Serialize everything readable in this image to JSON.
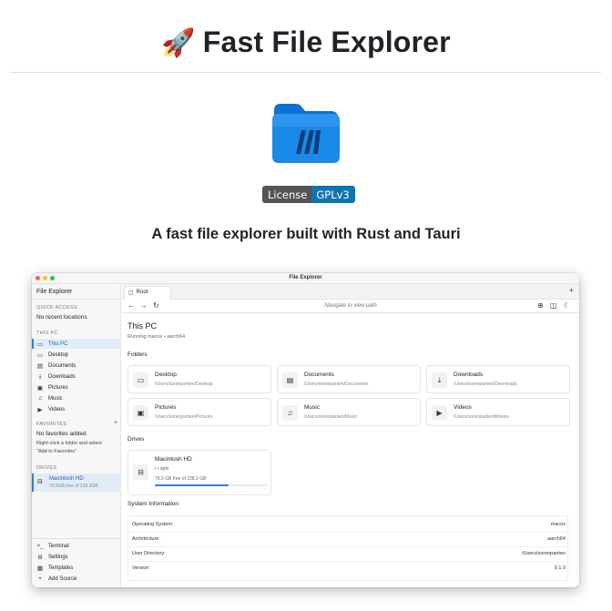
{
  "readme": {
    "title_emoji": "🚀",
    "title": "Fast File Explorer",
    "badge_label": "License",
    "badge_value": "GPLv3",
    "tagline": "A fast file explorer built with Rust and Tauri",
    "colors": {
      "badge_left": "#555555",
      "badge_right": "#0f74b4",
      "folder_blue": "#1a8ae8"
    }
  },
  "app": {
    "window_title": "File Explorer",
    "sidebar": {
      "header": "File Explorer",
      "quick_access": {
        "label": "QUICK ACCESS",
        "empty": "No recent locations"
      },
      "this_pc": {
        "label": "THIS PC",
        "items": [
          {
            "label": "This PC",
            "icon": "monitor-icon",
            "active": true
          },
          {
            "label": "Desktop",
            "icon": "monitor-icon"
          },
          {
            "label": "Documents",
            "icon": "document-icon"
          },
          {
            "label": "Downloads",
            "icon": "download-icon"
          },
          {
            "label": "Pictures",
            "icon": "image-icon"
          },
          {
            "label": "Music",
            "icon": "music-icon"
          },
          {
            "label": "Videos",
            "icon": "video-icon"
          }
        ]
      },
      "favorites": {
        "label": "FAVORITES",
        "add": "+",
        "empty": "No favorites added",
        "hint1": "Right-click a folder and select",
        "hint2": "\"Add to Favorites\""
      },
      "drives": {
        "label": "DRIVES",
        "item": {
          "name": "Macintosh HD",
          "free": "79.5GB free of 228.3GB"
        }
      },
      "bottom": [
        {
          "label": "Terminal",
          "icon": "terminal-icon"
        },
        {
          "label": "Settings",
          "icon": "gear-icon"
        },
        {
          "label": "Templates",
          "icon": "template-icon"
        },
        {
          "label": "Add Source",
          "icon": "plus-icon"
        }
      ]
    },
    "tab": {
      "label": "Root"
    },
    "tab_add": "+",
    "nav": {
      "path_placeholder": "Navigate to view path"
    },
    "page": {
      "title": "This PC",
      "subtitle": "Running macos • aarch64"
    },
    "folders_heading": "Folders",
    "folders": [
      {
        "name": "Desktop",
        "path": "/Users/sorenpanten/Desktop",
        "icon": "monitor-icon"
      },
      {
        "name": "Documents",
        "path": "/Users/sorenpanten/Documents",
        "icon": "document-icon"
      },
      {
        "name": "Downloads",
        "path": "/Users/sorenpanten/Downloads",
        "icon": "download-icon"
      },
      {
        "name": "Pictures",
        "path": "/Users/sorenpanten/Pictures",
        "icon": "image-icon"
      },
      {
        "name": "Music",
        "path": "/Users/sorenpanten/Music",
        "icon": "music-icon"
      },
      {
        "name": "Videos",
        "path": "/Users/sorenpanten/Movies",
        "icon": "video-icon"
      }
    ],
    "drives_heading": "Drives",
    "drive": {
      "name": "Macintosh HD",
      "fs": "/ • apfs",
      "free_text": "79.5 GB free of 228.3 GB",
      "used_fraction": 0.65
    },
    "sysinfo_heading": "System Information",
    "sysinfo": [
      {
        "key": "Operating System:",
        "value": "macos"
      },
      {
        "key": "Architecture:",
        "value": "aarch64"
      },
      {
        "key": "User Directory:",
        "value": "/Users/sorenpanten"
      },
      {
        "key": "Version:",
        "value": "0.1.0"
      }
    ],
    "accent": "#2f7de1"
  }
}
